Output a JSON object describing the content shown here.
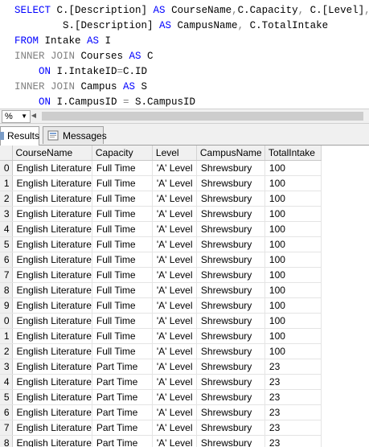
{
  "editor": {
    "lines": [
      {
        "segments": [
          {
            "text": "SELECT ",
            "cls": "kw"
          },
          {
            "text": "C.[Description] ",
            "cls": "txt"
          },
          {
            "text": "AS ",
            "cls": "kw"
          },
          {
            "text": "CourseName",
            "cls": "txt"
          },
          {
            "text": ",",
            "cls": "op"
          },
          {
            "text": "C.Capacity",
            "cls": "txt"
          },
          {
            "text": ", ",
            "cls": "op"
          },
          {
            "text": "C.[Level]",
            "cls": "txt"
          },
          {
            "text": ",",
            "cls": "op"
          }
        ]
      },
      {
        "segments": [
          {
            "text": "        S.[Description] ",
            "cls": "txt"
          },
          {
            "text": "AS ",
            "cls": "kw"
          },
          {
            "text": "CampusName",
            "cls": "txt"
          },
          {
            "text": ", ",
            "cls": "op"
          },
          {
            "text": "C.TotalIntake",
            "cls": "txt"
          }
        ]
      },
      {
        "segments": [
          {
            "text": "FROM ",
            "cls": "kw"
          },
          {
            "text": "Intake ",
            "cls": "txt"
          },
          {
            "text": "AS ",
            "cls": "kw"
          },
          {
            "text": "I",
            "cls": "txt"
          }
        ]
      },
      {
        "segments": [
          {
            "text": "INNER JOIN ",
            "cls": "jn"
          },
          {
            "text": "Courses ",
            "cls": "txt"
          },
          {
            "text": "AS ",
            "cls": "kw"
          },
          {
            "text": "C",
            "cls": "txt"
          }
        ]
      },
      {
        "segments": [
          {
            "text": "    ON ",
            "cls": "kw"
          },
          {
            "text": "I.IntakeID",
            "cls": "txt"
          },
          {
            "text": "=",
            "cls": "op"
          },
          {
            "text": "C.ID",
            "cls": "txt"
          }
        ]
      },
      {
        "segments": [
          {
            "text": "INNER JOIN ",
            "cls": "jn"
          },
          {
            "text": "Campus ",
            "cls": "txt"
          },
          {
            "text": "AS ",
            "cls": "kw"
          },
          {
            "text": "S",
            "cls": "txt"
          }
        ]
      },
      {
        "segments": [
          {
            "text": "    ON ",
            "cls": "kw"
          },
          {
            "text": "I.CampusID ",
            "cls": "txt"
          },
          {
            "text": "= ",
            "cls": "op"
          },
          {
            "text": "S.CampusID",
            "cls": "txt"
          }
        ]
      }
    ]
  },
  "zoom": {
    "value": "%"
  },
  "tabs": {
    "results_label": "Results",
    "messages_label": "Messages"
  },
  "grid": {
    "columns": [
      "CourseName",
      "Capacity",
      "Level",
      "CampusName",
      "TotalIntake"
    ],
    "rows": [
      {
        "n": "0",
        "cells": [
          "English Literature",
          "Full Time",
          "'A' Level",
          "Shrewsbury",
          "100"
        ]
      },
      {
        "n": "1",
        "cells": [
          "English Literature",
          "Full Time",
          "'A' Level",
          "Shrewsbury",
          "100"
        ]
      },
      {
        "n": "2",
        "cells": [
          "English Literature",
          "Full Time",
          "'A' Level",
          "Shrewsbury",
          "100"
        ]
      },
      {
        "n": "3",
        "cells": [
          "English Literature",
          "Full Time",
          "'A' Level",
          "Shrewsbury",
          "100"
        ]
      },
      {
        "n": "4",
        "cells": [
          "English Literature",
          "Full Time",
          "'A' Level",
          "Shrewsbury",
          "100"
        ]
      },
      {
        "n": "5",
        "cells": [
          "English Literature",
          "Full Time",
          "'A' Level",
          "Shrewsbury",
          "100"
        ]
      },
      {
        "n": "6",
        "cells": [
          "English Literature",
          "Full Time",
          "'A' Level",
          "Shrewsbury",
          "100"
        ]
      },
      {
        "n": "7",
        "cells": [
          "English Literature",
          "Full Time",
          "'A' Level",
          "Shrewsbury",
          "100"
        ]
      },
      {
        "n": "8",
        "cells": [
          "English Literature",
          "Full Time",
          "'A' Level",
          "Shrewsbury",
          "100"
        ]
      },
      {
        "n": "9",
        "cells": [
          "English Literature",
          "Full Time",
          "'A' Level",
          "Shrewsbury",
          "100"
        ]
      },
      {
        "n": "0",
        "cells": [
          "English Literature",
          "Full Time",
          "'A' Level",
          "Shrewsbury",
          "100"
        ]
      },
      {
        "n": "1",
        "cells": [
          "English Literature",
          "Full Time",
          "'A' Level",
          "Shrewsbury",
          "100"
        ]
      },
      {
        "n": "2",
        "cells": [
          "English Literature",
          "Full Time",
          "'A' Level",
          "Shrewsbury",
          "100"
        ]
      },
      {
        "n": "3",
        "cells": [
          "English Literature",
          "Part Time",
          "'A' Level",
          "Shrewsbury",
          "23"
        ]
      },
      {
        "n": "4",
        "cells": [
          "English Literature",
          "Part Time",
          "'A' Level",
          "Shrewsbury",
          "23"
        ]
      },
      {
        "n": "5",
        "cells": [
          "English Literature",
          "Part Time",
          "'A' Level",
          "Shrewsbury",
          "23"
        ]
      },
      {
        "n": "6",
        "cells": [
          "English Literature",
          "Part Time",
          "'A' Level",
          "Shrewsbury",
          "23"
        ]
      },
      {
        "n": "7",
        "cells": [
          "English Literature",
          "Part Time",
          "'A' Level",
          "Shrewsbury",
          "23"
        ]
      },
      {
        "n": "8",
        "cells": [
          "English Literature",
          "Part Time",
          "'A' Level",
          "Shrewsbury",
          "23"
        ]
      }
    ]
  },
  "colors": {
    "keyword": "#0000ff",
    "join": "#808080",
    "header_bg": "#f0f0f0"
  }
}
